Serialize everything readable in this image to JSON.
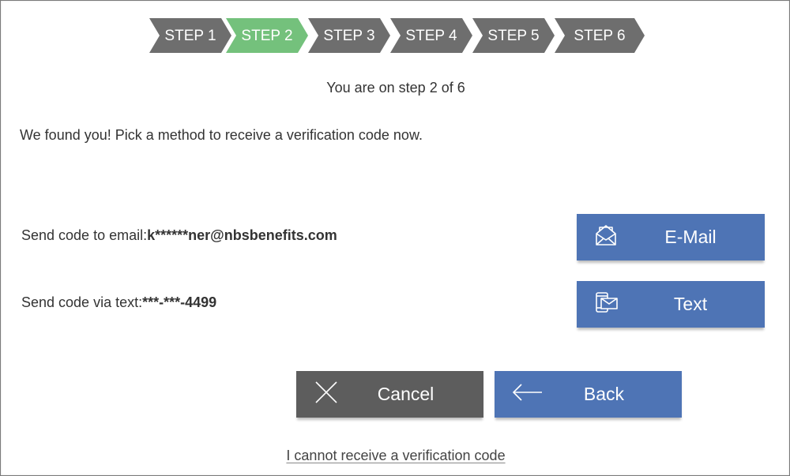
{
  "stepper": {
    "steps": [
      {
        "label": "STEP 1",
        "state": "inactive"
      },
      {
        "label": "STEP 2",
        "state": "active"
      },
      {
        "label": "STEP 3",
        "state": "inactive"
      },
      {
        "label": "STEP 4",
        "state": "inactive"
      },
      {
        "label": "STEP 5",
        "state": "inactive"
      },
      {
        "label": "STEP 6",
        "state": "inactive"
      }
    ],
    "active_color": "#74c17c",
    "inactive_color": "#6e6e6e"
  },
  "progress_text": "You are on step 2 of 6",
  "intro_text": "We found you! Pick a method to receive a verification code now.",
  "methods": {
    "email": {
      "label": "Send code to email:",
      "value": "k******ner@nbsbenefits.com",
      "button_label": "E-Mail",
      "icon": "envelope-icon"
    },
    "text": {
      "label": "Send code via text:",
      "value": "***-***-4499",
      "button_label": "Text",
      "icon": "phone-message-icon"
    }
  },
  "actions": {
    "cancel_label": "Cancel",
    "cancel_icon": "close-icon",
    "back_label": "Back",
    "back_icon": "arrow-left-icon"
  },
  "help_link": "I cannot receive a verification code",
  "colors": {
    "primary_button": "#4e74b5",
    "secondary_button": "#5d5d5d"
  }
}
